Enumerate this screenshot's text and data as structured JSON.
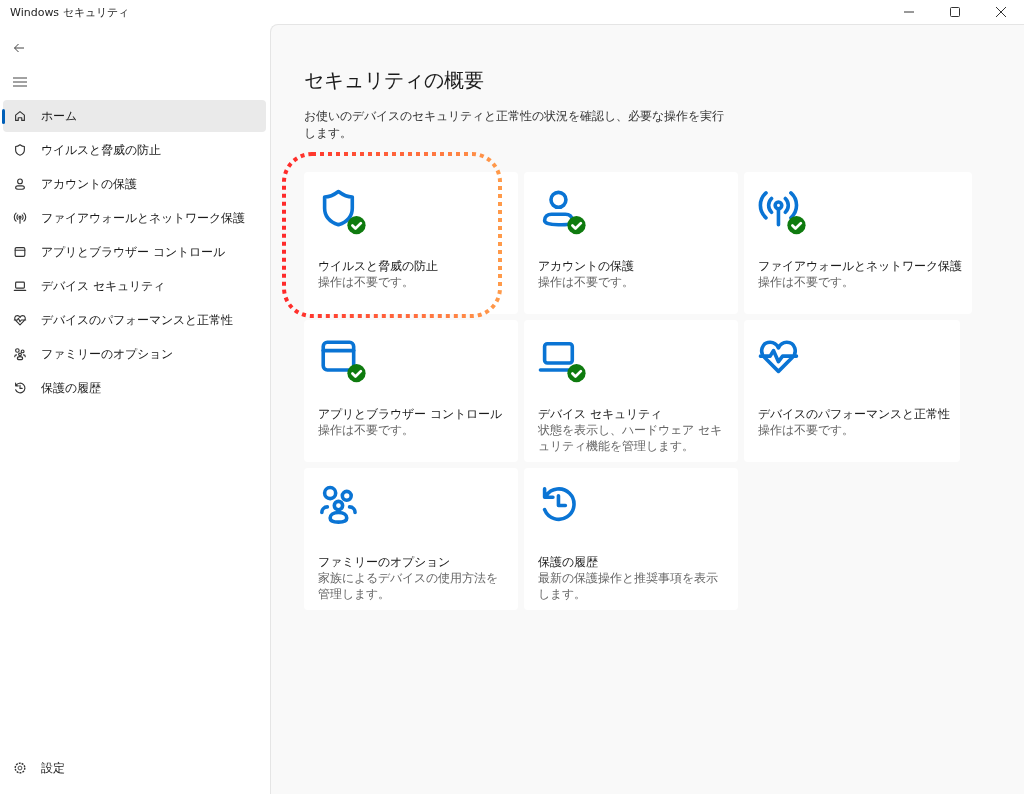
{
  "window": {
    "title": "Windows セキュリティ"
  },
  "nav": {
    "items": [
      {
        "kind": "home",
        "label": "ホーム",
        "selected": true
      },
      {
        "kind": "shield",
        "label": "ウイルスと脅威の防止",
        "selected": false
      },
      {
        "kind": "person",
        "label": "アカウントの保護",
        "selected": false
      },
      {
        "kind": "antenna",
        "label": "ファイアウォールとネットワーク保護",
        "selected": false
      },
      {
        "kind": "window",
        "label": "アプリとブラウザー コントロール",
        "selected": false
      },
      {
        "kind": "laptop",
        "label": "デバイス セキュリティ",
        "selected": false
      },
      {
        "kind": "heart",
        "label": "デバイスのパフォーマンスと正常性",
        "selected": false
      },
      {
        "kind": "family",
        "label": "ファミリーのオプション",
        "selected": false
      },
      {
        "kind": "history",
        "label": "保護の履歴",
        "selected": false
      }
    ],
    "settings": "設定"
  },
  "main": {
    "title": "セキュリティの概要",
    "description": "お使いのデバイスのセキュリティと正常性の状況を確認し、必要な操作を実行します。",
    "tiles": [
      {
        "kind": "shield",
        "title": "ウイルスと脅威の防止",
        "status": "操作は不要です。",
        "ok": true,
        "highlighted": true
      },
      {
        "kind": "person",
        "title": "アカウントの保護",
        "status": "操作は不要です。",
        "ok": true,
        "highlighted": false
      },
      {
        "kind": "antenna",
        "title": "ファイアウォールとネットワーク保護",
        "status": "操作は不要です。",
        "ok": true,
        "highlighted": false
      },
      {
        "kind": "window",
        "title": "アプリとブラウザー コントロール",
        "status": "操作は不要です。",
        "ok": true,
        "highlighted": false
      },
      {
        "kind": "laptop",
        "title": "デバイス セキュリティ",
        "status": "状態を表示し、ハードウェア セキュリティ機能を管理します。",
        "ok": true,
        "highlighted": false
      },
      {
        "kind": "heart",
        "title": "デバイスのパフォーマンスと正常性",
        "status": "操作は不要です。",
        "ok": false,
        "highlighted": false
      },
      {
        "kind": "family",
        "title": "ファミリーのオプション",
        "status": "家族によるデバイスの使用方法を管理します。",
        "ok": false,
        "highlighted": false
      },
      {
        "kind": "history",
        "title": "保護の履歴",
        "status": "最新の保護操作と推奨事項を表示します。",
        "ok": false,
        "highlighted": false
      }
    ]
  }
}
